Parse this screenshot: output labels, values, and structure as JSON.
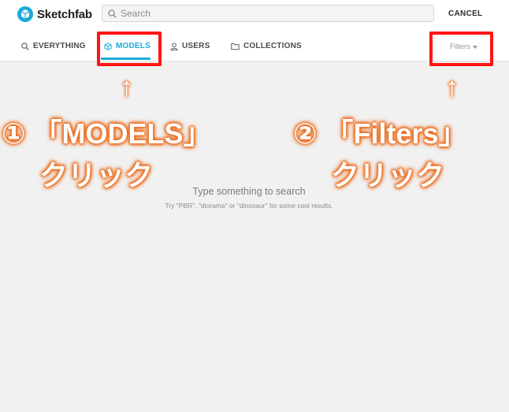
{
  "header": {
    "logo_text": "Sketchfab",
    "search_placeholder": "Search",
    "cancel_label": "CANCEL"
  },
  "tabs": [
    {
      "label": "EVERYTHING",
      "icon": "search-icon"
    },
    {
      "label": "MODELS",
      "icon": "cube-icon",
      "active": true
    },
    {
      "label": "USERS",
      "icon": "user-icon"
    },
    {
      "label": "COLLECTIONS",
      "icon": "folder-icon"
    }
  ],
  "filters_label": "Filters",
  "empty_state": {
    "title": "Type something to search",
    "hint": "Try \"PBR\", \"diorama\" or \"dinosaur\" for some cool results."
  },
  "annotations": {
    "arrow_glyph": "↑",
    "step1_line1": "① 「MODELS」",
    "step1_line2": "クリック",
    "step2_line1": "② 「Filters」",
    "step2_line2": "クリック"
  },
  "colors": {
    "accent": "#1caad9",
    "highlight": "#ff1414",
    "callout_glow": "#ea6d1f",
    "background": "#f1f1f1"
  }
}
